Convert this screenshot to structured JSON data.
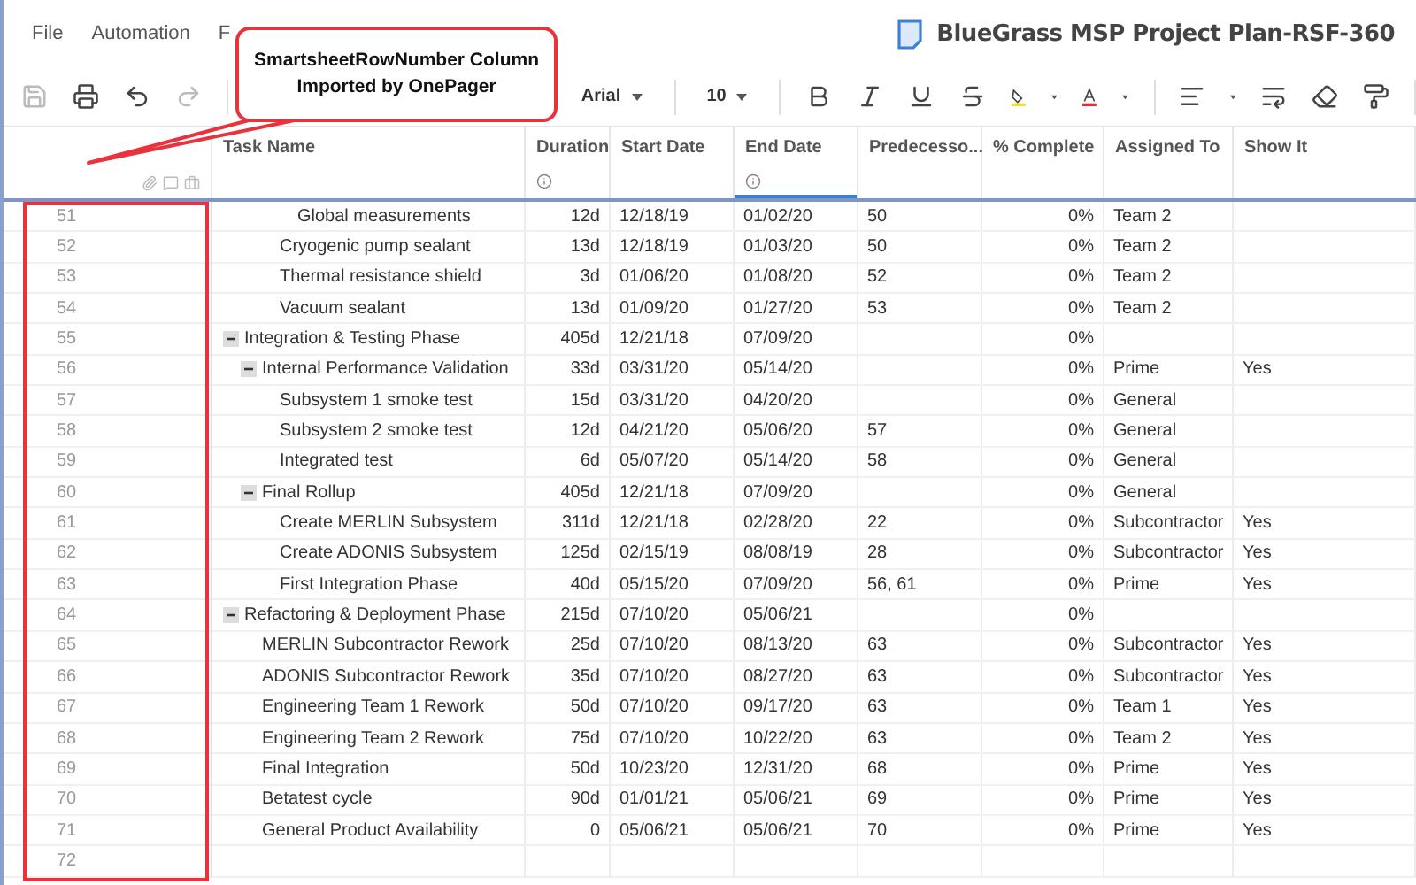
{
  "menu": [
    {
      "label": "File"
    },
    {
      "label": "Automation"
    },
    {
      "label": "F"
    }
  ],
  "document": {
    "title": "BlueGrass MSP Project Plan-RSF-360"
  },
  "toolbar": {
    "font": "Arial",
    "font_size": "10"
  },
  "callout": {
    "text": "SmartsheetRowNumber Column Imported by OnePager"
  },
  "table": {
    "columns": [
      {
        "label": "Task Name",
        "info": false,
        "selected": false
      },
      {
        "label": "Duration",
        "info": true,
        "selected": false
      },
      {
        "label": "Start Date",
        "info": false,
        "selected": false
      },
      {
        "label": "End Date",
        "info": true,
        "selected": true
      },
      {
        "label": "Predecesso...",
        "info": false,
        "selected": false
      },
      {
        "label": "% Complete",
        "info": false,
        "selected": false
      },
      {
        "label": "Assigned To",
        "info": false,
        "selected": false
      },
      {
        "label": "Show It",
        "info": false,
        "selected": false
      }
    ],
    "rows": [
      {
        "children": [
          {
            "children": [
              {
                "children": [
                  {
                    "num": "51",
                    "task": "Global measurements",
                    "duration": "12d",
                    "start": "12/18/19",
                    "end": "01/02/20",
                    "pred": "50",
                    "complete": "0%",
                    "assigned": "Team 2"
                  }
                ]
              },
              {
                "num": "52",
                "task": "Cryogenic pump sealant",
                "duration": "13d",
                "start": "12/18/19",
                "end": "01/03/20",
                "pred": "50",
                "complete": "0%",
                "assigned": "Team 2"
              },
              {
                "num": "53",
                "task": "Thermal resistance shield",
                "duration": "3d",
                "start": "01/06/20",
                "end": "01/08/20",
                "pred": "52",
                "complete": "0%",
                "assigned": "Team 2"
              },
              {
                "num": "54",
                "task": "Vacuum sealant",
                "duration": "13d",
                "start": "01/09/20",
                "end": "01/27/20",
                "pred": "53",
                "complete": "0%",
                "assigned": "Team 2"
              }
            ]
          }
        ]
      },
      {
        "num": "55",
        "task": "Integration & Testing Phase",
        "duration": "405d",
        "start": "12/21/18",
        "end": "07/09/20",
        "complete": "0%",
        "expanded": true,
        "children": [
          {
            "num": "56",
            "task": "Internal Performance Validation",
            "duration": "33d",
            "start": "03/31/20",
            "end": "05/14/20",
            "complete": "0%",
            "assigned": "Prime",
            "show": "Yes",
            "expanded": true,
            "children": [
              {
                "num": "57",
                "task": "Subsystem 1 smoke test",
                "duration": "15d",
                "start": "03/31/20",
                "end": "04/20/20",
                "complete": "0%",
                "assigned": "General"
              },
              {
                "num": "58",
                "task": "Subsystem 2 smoke test",
                "duration": "12d",
                "start": "04/21/20",
                "end": "05/06/20",
                "pred": "57",
                "complete": "0%",
                "assigned": "General"
              },
              {
                "num": "59",
                "task": "Integrated test",
                "duration": "6d",
                "start": "05/07/20",
                "end": "05/14/20",
                "pred": "58",
                "complete": "0%",
                "assigned": "General"
              }
            ]
          },
          {
            "num": "60",
            "task": "Final Rollup",
            "duration": "405d",
            "start": "12/21/18",
            "end": "07/09/20",
            "complete": "0%",
            "assigned": "General",
            "expanded": true,
            "children": [
              {
                "num": "61",
                "task": "Create MERLIN Subsystem",
                "duration": "311d",
                "start": "12/21/18",
                "end": "02/28/20",
                "pred": "22",
                "complete": "0%",
                "assigned": "Subcontractor",
                "show": "Yes"
              },
              {
                "num": "62",
                "task": "Create ADONIS Subsystem",
                "duration": "125d",
                "start": "02/15/19",
                "end": "08/08/19",
                "pred": "28",
                "complete": "0%",
                "assigned": "Subcontractor",
                "show": "Yes"
              },
              {
                "num": "63",
                "task": "First Integration Phase",
                "duration": "40d",
                "start": "05/15/20",
                "end": "07/09/20",
                "pred": "56, 61",
                "complete": "0%",
                "assigned": "Prime",
                "show": "Yes"
              }
            ]
          }
        ]
      },
      {
        "num": "64",
        "task": "Refactoring & Deployment Phase",
        "duration": "215d",
        "start": "07/10/20",
        "end": "05/06/21",
        "complete": "0%",
        "expanded": true,
        "children": [
          {
            "num": "65",
            "task": "MERLIN Subcontractor Rework",
            "duration": "25d",
            "start": "07/10/20",
            "end": "08/13/20",
            "pred": "63",
            "complete": "0%",
            "assigned": "Subcontractor",
            "show": "Yes"
          },
          {
            "num": "66",
            "task": "ADONIS Subcontractor Rework",
            "duration": "35d",
            "start": "07/10/20",
            "end": "08/27/20",
            "pred": "63",
            "complete": "0%",
            "assigned": "Subcontractor",
            "show": "Yes"
          },
          {
            "num": "67",
            "task": "Engineering Team 1 Rework",
            "duration": "50d",
            "start": "07/10/20",
            "end": "09/17/20",
            "pred": "63",
            "complete": "0%",
            "assigned": "Team 1",
            "show": "Yes"
          },
          {
            "num": "68",
            "task": "Engineering Team 2 Rework",
            "duration": "75d",
            "start": "07/10/20",
            "end": "10/22/20",
            "pred": "63",
            "complete": "0%",
            "assigned": "Team 2",
            "show": "Yes"
          },
          {
            "num": "69",
            "task": "Final Integration",
            "duration": "50d",
            "start": "10/23/20",
            "end": "12/31/20",
            "pred": "68",
            "complete": "0%",
            "assigned": "Prime",
            "show": "Yes"
          },
          {
            "num": "70",
            "task": "Betatest cycle",
            "duration": "90d",
            "start": "01/01/21",
            "end": "05/06/21",
            "pred": "69",
            "complete": "0%",
            "assigned": "Prime",
            "show": "Yes"
          },
          {
            "num": "71",
            "task": "General Product Availability",
            "duration": "0",
            "start": "05/06/21",
            "end": "05/06/21",
            "pred": "70",
            "complete": "0%",
            "assigned": "Prime",
            "show": "Yes"
          }
        ]
      },
      {
        "num": "72"
      }
    ]
  }
}
